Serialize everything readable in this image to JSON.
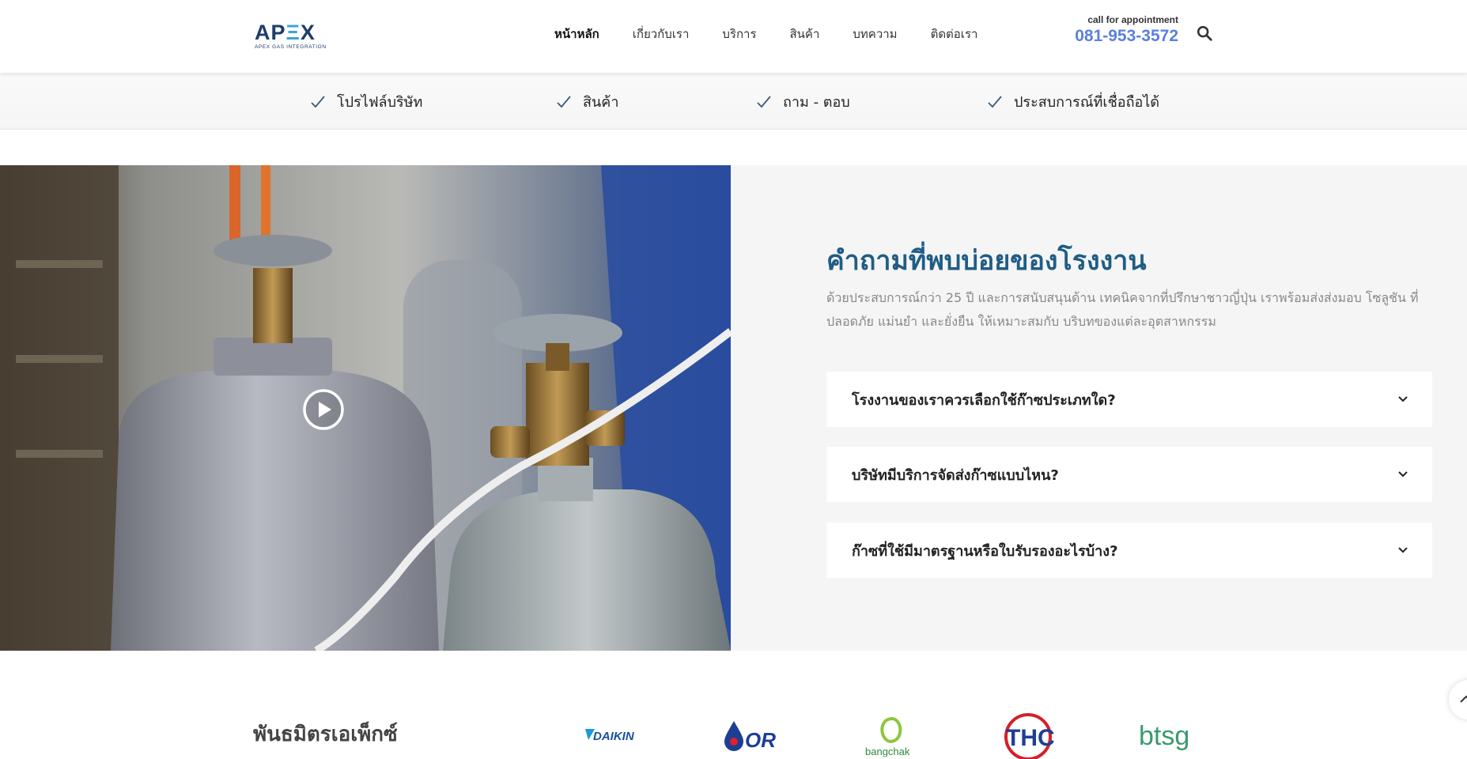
{
  "header": {
    "logo_text": "APEX",
    "logo_subtitle": "APEX GAS INTEGRATION",
    "nav": [
      "หน้าหลัก",
      "เกี่ยวกับเรา",
      "บริการ",
      "สินค้า",
      "บทความ",
      "ติดต่อเรา"
    ],
    "appointment_label": "call for appointment",
    "phone": "081-953-3572",
    "search_icon": "search-icon"
  },
  "subbar": {
    "items": [
      "โปรไฟล์บริษัท",
      "สินค้า",
      "ถาม - ตอบ",
      "ประสบการณ์ที่เชื่อถือได้"
    ],
    "icon": "check-icon"
  },
  "media": {
    "play_icon": "play-icon"
  },
  "faq": {
    "title": "คำถามที่พบบ่อยของโรงงาน",
    "description": "ด้วยประสบการณ์กว่า 25 ปี และการสนับสนุนด้าน เทคนิคจากที่ปรึกษาชาวญี่ปุ่น เราพร้อมส่งส่งมอบ โซลูชัน ที่ปลอดภัย แม่นยำ และยั่งยืน ให้เหมาะสมกับ บริบทของแต่ละอุตสาหกรรม",
    "questions": [
      "โรงงานของเราควรเลือกใช้ก๊าซประเภทใด?",
      "บริษัทมีบริการจัดส่งก๊าซแบบไหน?",
      "ก๊าซที่ใช้มีมาตรฐานหรือใบรับรองอะไรบ้าง?"
    ],
    "chevron_icon": "chevron-down-icon"
  },
  "partners": {
    "title": "พันธมิตรเอเพ็กซ์",
    "logos": [
      "DAIKIN",
      "OR",
      "bangchak",
      "THC",
      "btsg"
    ]
  },
  "colors": {
    "accent_blue": "#1f5d86",
    "phone_blue": "#5b7fe0",
    "brand_navy": "#1e3d6b"
  }
}
